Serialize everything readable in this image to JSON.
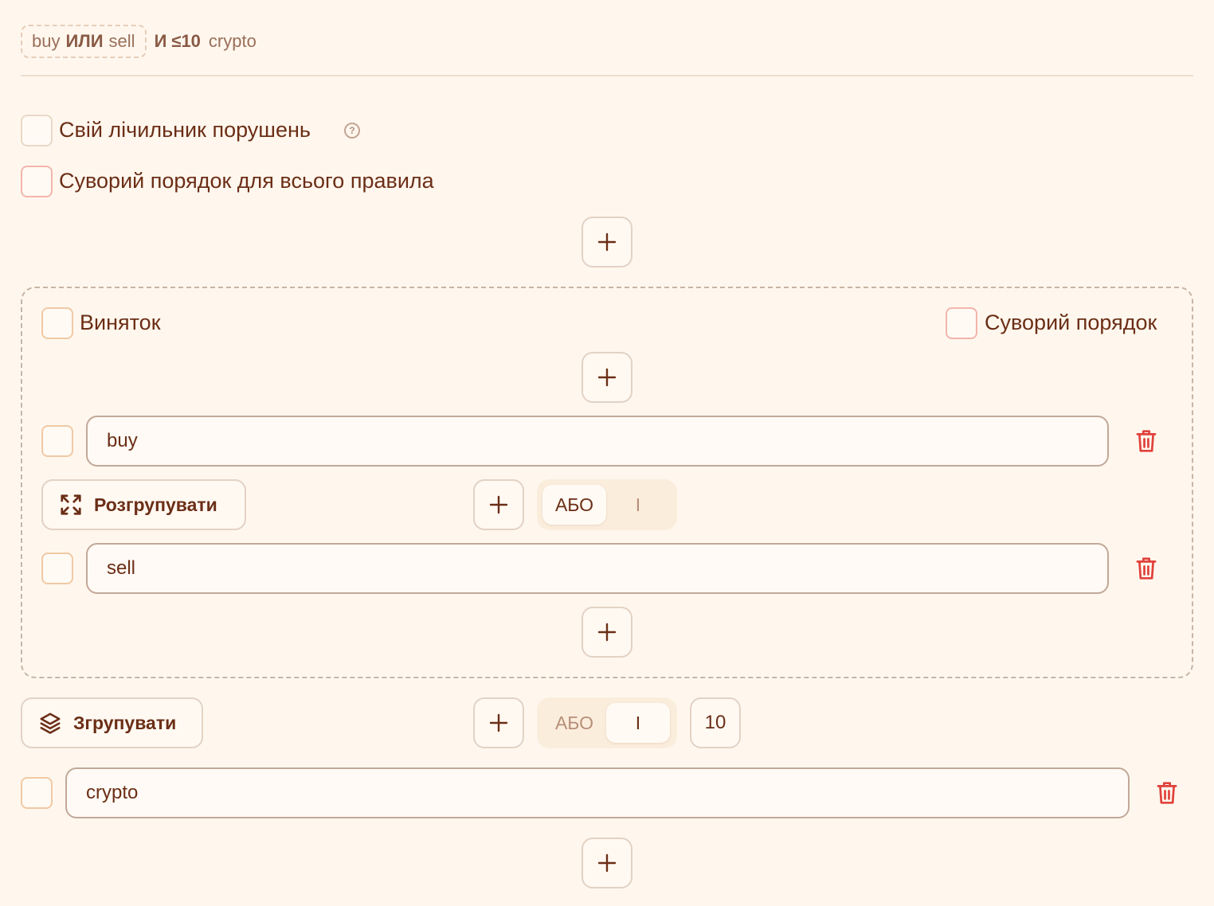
{
  "summary": {
    "group": {
      "left": "buy",
      "op": "ИЛИ",
      "right": "sell"
    },
    "and_op": "И",
    "count": "≤10",
    "term": "crypto"
  },
  "options": {
    "custom_counter_label": "Свій лічильник порушень",
    "strict_order_rule_label": "Суворий порядок для всього правила"
  },
  "group": {
    "exception_label": "Виняток",
    "strict_order_label": "Суворий порядок",
    "terms": [
      {
        "value": "buy"
      },
      {
        "value": "sell"
      }
    ],
    "ungroup_label": "Розгрупувати",
    "operator": {
      "or": "АБО",
      "and": "І",
      "selected": "or"
    }
  },
  "outer": {
    "group_label": "Згрупувати",
    "operator": {
      "or": "АБО",
      "and": "І",
      "selected": "and"
    },
    "count": "10",
    "terms": [
      {
        "value": "crypto"
      }
    ]
  },
  "colors": {
    "background": "#fff7ee",
    "text": "#6b2e16",
    "delete": "#e0413b",
    "checkbox_border": "#f1c9a4"
  },
  "icons": [
    "help-icon",
    "plus-icon",
    "trash-icon",
    "expand-icon",
    "layers-icon"
  ]
}
